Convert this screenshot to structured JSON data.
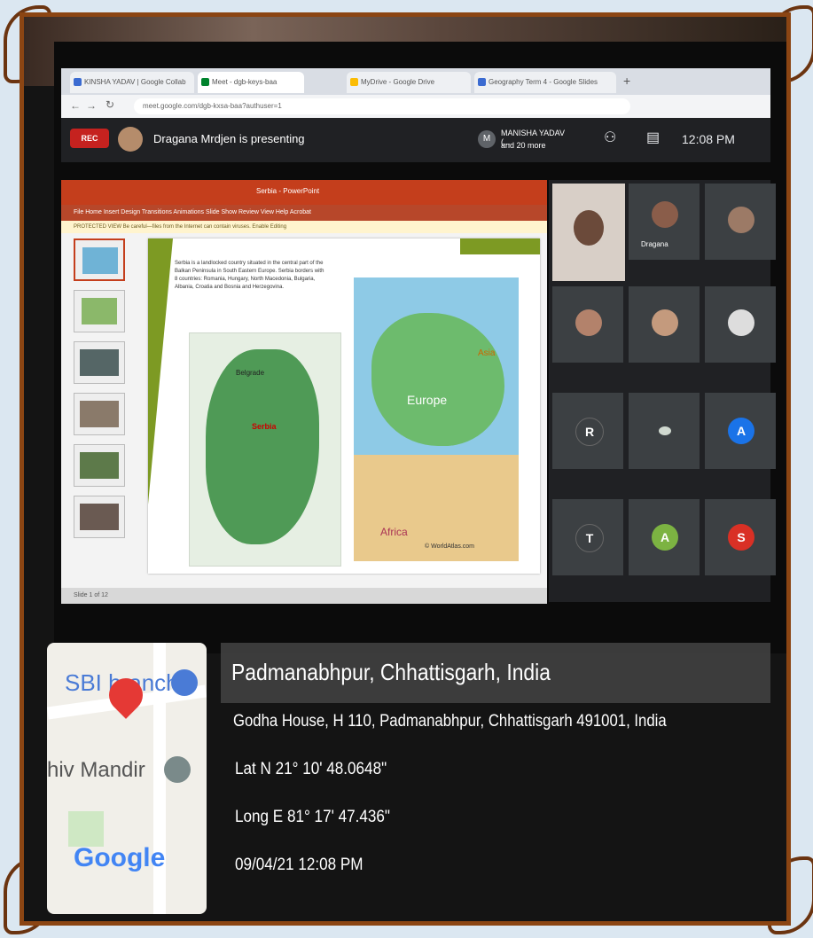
{
  "browser": {
    "tabs": [
      "KINSHA YADAV | Google Collab",
      "Meet - dgb-keys-baa",
      "MyDrive - Google Drive",
      "Geography Term 4 - Google Slides"
    ],
    "url": "meet.google.com/dgb-kxsa-baa?authuser=1"
  },
  "meet": {
    "rec_label": "REC",
    "presenter_text": "Dragana Mrdjen is presenting",
    "participant_name": "MANISHA YADAV (...",
    "participant_more": "and 20 more",
    "participant_initial": "M",
    "time": "12:08 PM",
    "tile_label": "Dragana",
    "tiles": [
      {
        "initial": "R",
        "color": "#3c4043"
      },
      {
        "initial": "",
        "color": "#3c4043"
      },
      {
        "initial": "A",
        "color": "#1a73e8"
      },
      {
        "initial": "T",
        "color": "#3c4043"
      },
      {
        "initial": "A",
        "color": "#7cb342"
      },
      {
        "initial": "S",
        "color": "#d93025"
      }
    ]
  },
  "slide": {
    "ribbon_title": "Serbia - PowerPoint",
    "menu": "File   Home   Insert   Design   Transitions   Animations   Slide Show   Review   View   Help   Acrobat",
    "warning": "PROTECTED VIEW  Be careful—files from the Internet can contain viruses.  Enable Editing",
    "body_text": "Serbia is a landlocked country situated in the central part of the Balkan Peninsula in South Eastern Europe. Serbia borders with 8 countries: Romania, Hungary, North Macedonia, Bulgaria, Albania, Croatia and Bosnia and Herzegovina.",
    "serbia_label": "Serbia",
    "city_label": "Belgrade",
    "europe_label": "Europe",
    "asia_label": "Asia",
    "africa_label": "Africa",
    "credit": "© WorldAtlas.com",
    "status": "Slide 1 of 12"
  },
  "geotag": {
    "place": "Padmanabhpur, Chhattisgarh, India",
    "address": "Godha House, H 110, Padmanabhpur, Chhattisgarh 491001, India",
    "lat": "Lat N 21° 10' 48.0648\"",
    "long": "Long E 81° 17' 47.436\"",
    "datetime": "09/04/21 12:08 PM",
    "map_label_bank": "SBI branch",
    "map_label_temple": "hiv Mandir",
    "map_brand": "Google"
  },
  "colors": {
    "frame": "#8b4513",
    "meet_bg": "#202124",
    "rec": "#c5221f",
    "ppt_red": "#c43e1c"
  }
}
